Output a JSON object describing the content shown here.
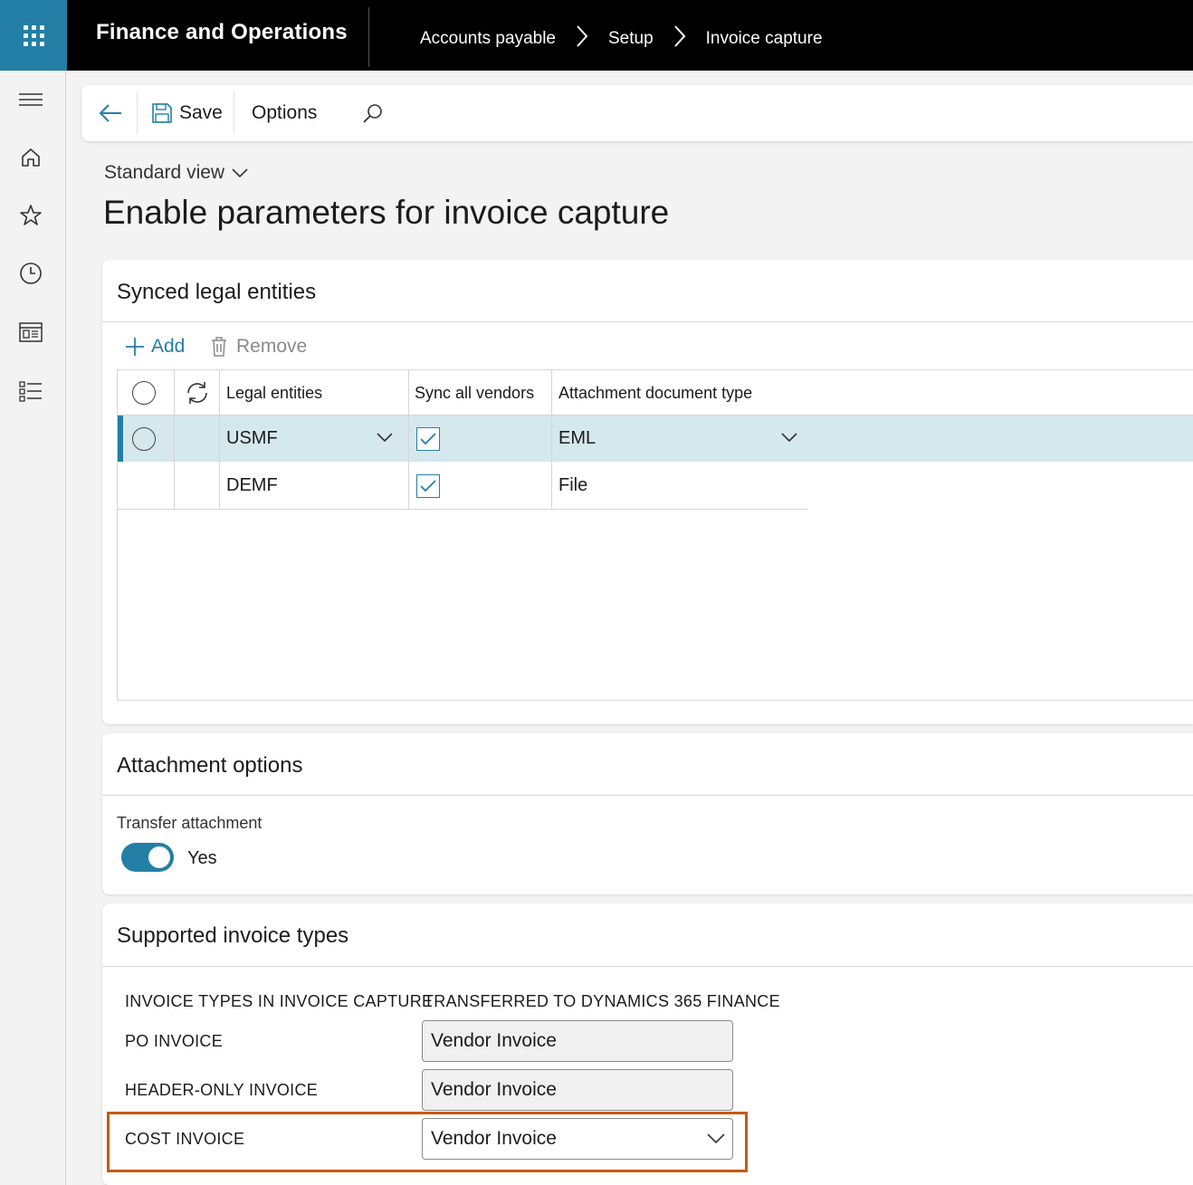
{
  "app": {
    "title": "Finance and Operations",
    "breadcrumbs": [
      "Accounts payable",
      "Setup",
      "Invoice capture"
    ]
  },
  "toolbar": {
    "save_label": "Save",
    "options_label": "Options"
  },
  "view": {
    "label": "Standard view"
  },
  "page_title": "Enable parameters for invoice capture",
  "synced": {
    "title": "Synced legal entities",
    "add_label": "Add",
    "remove_label": "Remove",
    "columns": [
      "Legal entities",
      "Sync all vendors",
      "Attachment document type"
    ],
    "rows": [
      {
        "entity": "USMF",
        "sync_all": true,
        "doc_type": "EML",
        "selected": true
      },
      {
        "entity": "DEMF",
        "sync_all": true,
        "doc_type": "File",
        "selected": false
      }
    ]
  },
  "attachment": {
    "title": "Attachment options",
    "transfer_label": "Transfer attachment",
    "transfer_value": "Yes"
  },
  "invoice_types": {
    "title": "Supported invoice types",
    "col1": "INVOICE TYPES IN INVOICE CAPTURE",
    "col2": "TRANSFERRED TO DYNAMICS 365 FINANCE",
    "rows": [
      {
        "type": "PO INVOICE",
        "value": "Vendor Invoice"
      },
      {
        "type": "HEADER-ONLY INVOICE",
        "value": "Vendor Invoice"
      },
      {
        "type": "COST INVOICE",
        "value": "Vendor Invoice"
      }
    ]
  },
  "colors": {
    "accent": "#237fa6",
    "highlight": "#c55a11",
    "selected_row": "#d5e8ee"
  }
}
